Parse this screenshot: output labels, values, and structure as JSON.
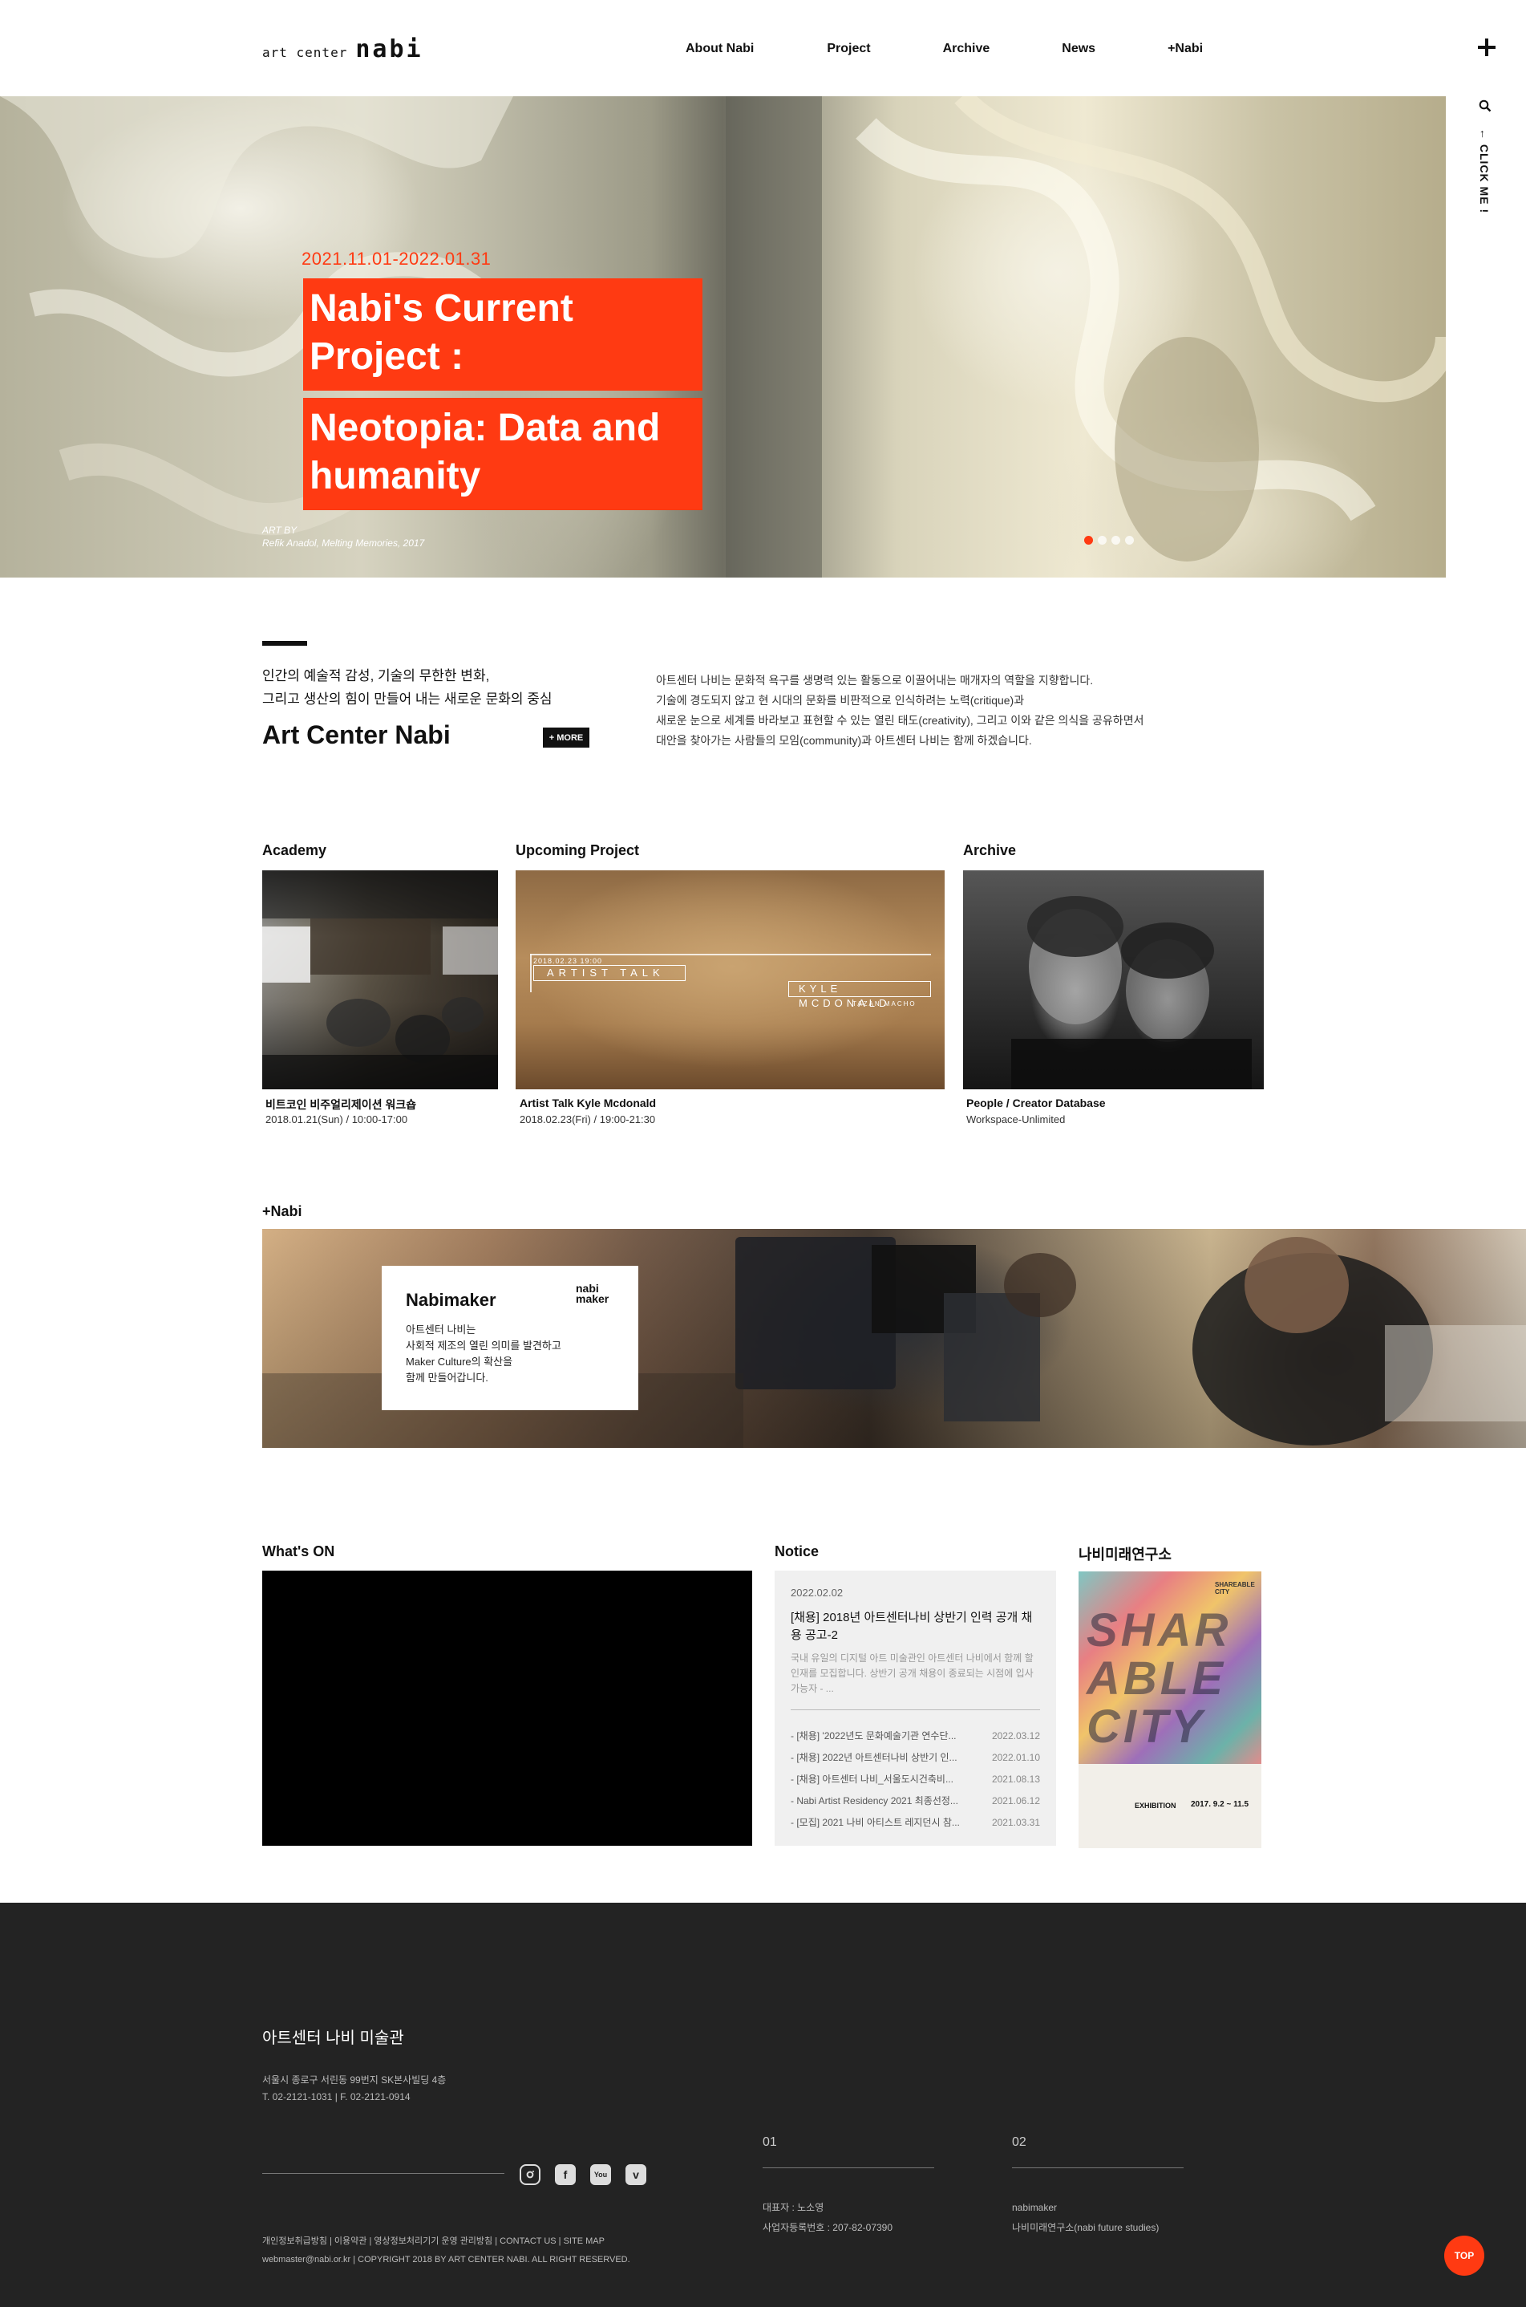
{
  "header": {
    "logo_small": "art center",
    "logo_big": "nabi",
    "nav": [
      "About Nabi",
      "Project",
      "Archive",
      "News",
      "+Nabi"
    ],
    "menu_icon": "plus-icon"
  },
  "rail": {
    "search_icon": "search-icon",
    "click_me": "← CLICK ME !"
  },
  "hero": {
    "date": "2021.11.01-2022.01.31",
    "title_line1": "Nabi's Current Project :",
    "title_line2": "Neotopia: Data and humanity",
    "credit_label": "ART BY",
    "credit_text": "Refik Anadol, Melting Memories, 2017",
    "slide_count": 4,
    "active_slide": 1
  },
  "intro": {
    "tagline1": "인간의 예술적 감성, 기술의 무한한 변화,",
    "tagline2": "그리고 생산의 힘이 만들어 내는 새로운 문화의 중심",
    "title": "Art Center Nabi",
    "more_label": "+ MORE",
    "desc1": "아트센터 나비는 문화적 욕구를 생명력 있는 활동으로 이끌어내는 매개자의 역할을 지향합니다.",
    "desc2": "기술에 경도되지 않고 현 시대의 문화를 비판적으로 인식하려는 노력(critique)과",
    "desc3": "새로운 눈으로 세계를 바라보고 표현할 수 있는 열린 태도(creativity), 그리고 이와 같은 의식을 공유하면서",
    "desc4": "대안을 찾아가는 사람들의 모임(community)과 아트센터 나비는 함께 하겠습니다."
  },
  "cards": [
    {
      "heading": "Academy",
      "title": "비트코인 비주얼리제이션 워크숍",
      "sub": "2018.01.21(Sun) / 10:00-17:00"
    },
    {
      "heading": "Upcoming Project",
      "title": "Artist Talk Kyle Mcdonald",
      "sub": "2018.02.23(Fri) / 19:00-21:30",
      "overlay": {
        "date": "2018.02.23 19:00",
        "left": "ARTIST TALK",
        "right": "KYLE MCDONALD",
        "sub": "TAZAN MACHO"
      }
    },
    {
      "heading": "Archive",
      "title": "People / Creator Database",
      "sub": "Workspace-Unlimited"
    }
  ],
  "plusnabi": {
    "heading": "+Nabi",
    "card_title": "Nabimaker",
    "logo_top": "nabi",
    "logo_bottom": "maker",
    "desc1": "아트센터 나비는",
    "desc2": "사회적 제조의 열린 의미를 발견하고",
    "desc3": "Maker Culture의 확산을",
    "desc4": "함께 만들어갑니다."
  },
  "whats_on": {
    "heading": "What's ON"
  },
  "notice": {
    "heading": "Notice",
    "date": "2022.02.02",
    "title": "[채용] 2018년 아트센터나비 상반기 인력 공개 채용 공고-2",
    "body": "국내 유일의 디지털 아트 미술관인 아트센터 나비에서 함께 할 인재를 모집합니다. 상반기 공개 채용이 종료되는 시점에 입사 가능자 - ...",
    "items": [
      {
        "title": "- [채용] '2022년도 문화예술기관 연수단...",
        "date": "2022.03.12"
      },
      {
        "title": "- [채용] 2022년 아트센터나비 상반기 인...",
        "date": "2022.01.10"
      },
      {
        "title": "- [채용] 아트센터 나비_서울도시건축비...",
        "date": "2021.08.13"
      },
      {
        "title": "- Nabi Artist Residency 2021 최종선정...",
        "date": "2021.06.12"
      },
      {
        "title": "- [모집] 2021 나비 아티스트 레지던시 참...",
        "date": "2021.03.31"
      }
    ]
  },
  "lab": {
    "heading": "나비미래연구소",
    "poster_words": [
      "SHAR",
      "ABLE",
      "CITY"
    ],
    "poster_corner": "SHAREABLE CITY",
    "poster_label": "EXHIBITION",
    "poster_date": "2017. 9.2 ~ 11.5"
  },
  "footer": {
    "title": "아트센터 나비 미술관",
    "address": "서울시 종로구 서린동 99번지 SK본사빌딩 4층",
    "phone": "T. 02-2121-1031  |  F. 02-2121-0914",
    "social": [
      "instagram-icon",
      "facebook-icon",
      "youtube-icon",
      "vimeo-icon"
    ],
    "col1_num": "01",
    "col1_line1": "대표자 : 노소영",
    "col1_line2": "사업자등록번호 : 207-82-07390",
    "col2_num": "02",
    "col2_line1": "nabimaker",
    "col2_line2": "나비미래연구소(nabi future studies)",
    "links": "개인정보취급방침  |  이용약관  |  영상정보처리기기 운영 관리방침  |  CONTACT US  |  SITE MAP",
    "copyright": "webmaster@nabi.or.kr  |  COPYRIGHT 2018 BY ART CENTER NABI. ALL RIGHT RESERVED.",
    "top_label": "TOP"
  },
  "colors": {
    "accent": "#ff3a12",
    "footer_bg": "#232323",
    "notice_bg": "#f0f0f0"
  }
}
